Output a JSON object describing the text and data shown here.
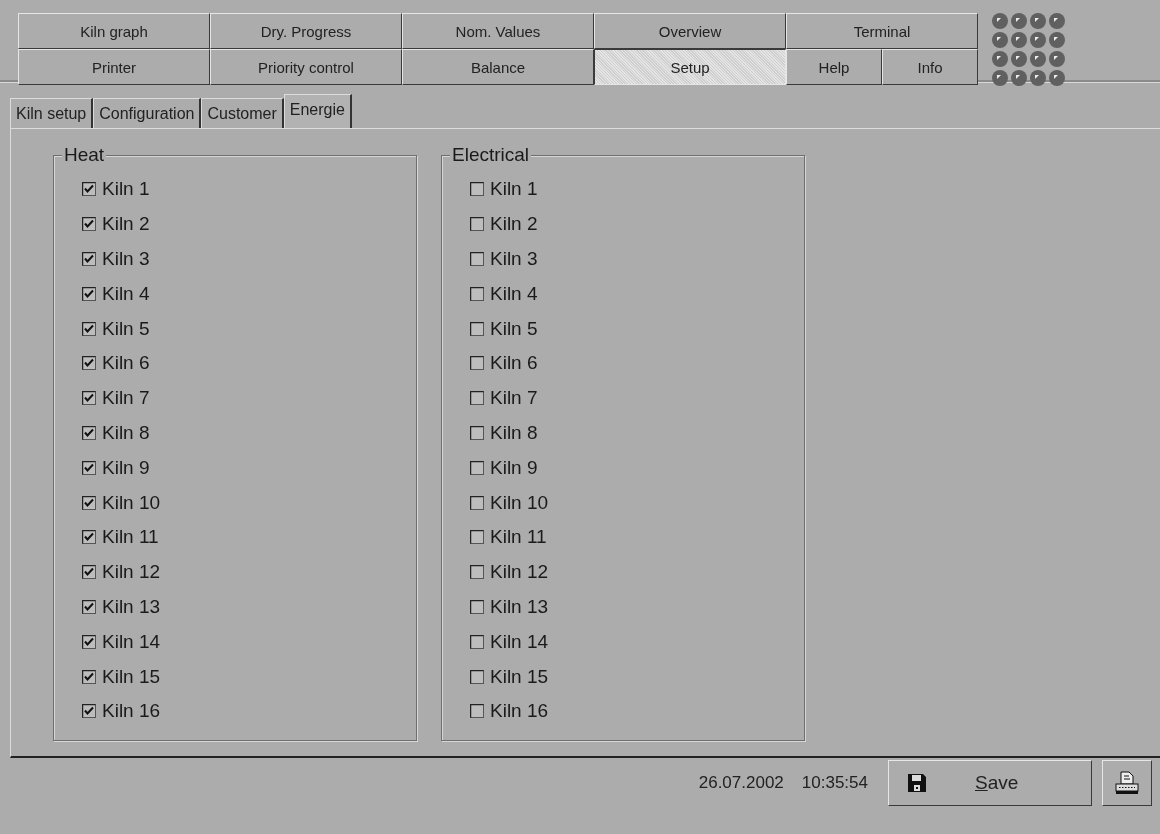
{
  "nav": [
    [
      {
        "label": "Kiln graph",
        "selected": false
      },
      {
        "label": "Dry. Progress",
        "selected": false
      },
      {
        "label": "Nom. Values",
        "selected": false
      },
      {
        "label": "Overview",
        "selected": false
      },
      {
        "label": "Terminal",
        "selected": false
      }
    ],
    [
      {
        "label": "Printer",
        "selected": false
      },
      {
        "label": "Priority control",
        "selected": false
      },
      {
        "label": "Balance",
        "selected": false
      },
      {
        "label": "Setup",
        "selected": true
      },
      {
        "label": "Help",
        "selected": false
      },
      {
        "label": "Info",
        "selected": false
      }
    ]
  ],
  "tabs": [
    {
      "label": "Kiln setup",
      "selected": false
    },
    {
      "label": "Configuration",
      "selected": false
    },
    {
      "label": "Customer",
      "selected": false
    },
    {
      "label": "Energie",
      "selected": true
    }
  ],
  "groups": [
    {
      "title": "Heat",
      "items": [
        {
          "label": "Kiln 1",
          "checked": true
        },
        {
          "label": "Kiln 2",
          "checked": true
        },
        {
          "label": "Kiln 3",
          "checked": true
        },
        {
          "label": "Kiln 4",
          "checked": true
        },
        {
          "label": "Kiln 5",
          "checked": true
        },
        {
          "label": "Kiln 6",
          "checked": true
        },
        {
          "label": "Kiln 7",
          "checked": true
        },
        {
          "label": "Kiln 8",
          "checked": true
        },
        {
          "label": "Kiln 9",
          "checked": true
        },
        {
          "label": "Kiln 10",
          "checked": true
        },
        {
          "label": "Kiln 11",
          "checked": true
        },
        {
          "label": "Kiln 12",
          "checked": true
        },
        {
          "label": "Kiln 13",
          "checked": true
        },
        {
          "label": "Kiln 14",
          "checked": true
        },
        {
          "label": "Kiln 15",
          "checked": true
        },
        {
          "label": "Kiln 16",
          "checked": true
        }
      ]
    },
    {
      "title": "Electrical",
      "items": [
        {
          "label": "Kiln 1",
          "checked": false
        },
        {
          "label": "Kiln 2",
          "checked": false
        },
        {
          "label": "Kiln 3",
          "checked": false
        },
        {
          "label": "Kiln 4",
          "checked": false
        },
        {
          "label": "Kiln 5",
          "checked": false
        },
        {
          "label": "Kiln 6",
          "checked": false
        },
        {
          "label": "Kiln 7",
          "checked": false
        },
        {
          "label": "Kiln 8",
          "checked": false
        },
        {
          "label": "Kiln 9",
          "checked": false
        },
        {
          "label": "Kiln 10",
          "checked": false
        },
        {
          "label": "Kiln 11",
          "checked": false
        },
        {
          "label": "Kiln 12",
          "checked": false
        },
        {
          "label": "Kiln 13",
          "checked": false
        },
        {
          "label": "Kiln 14",
          "checked": false
        },
        {
          "label": "Kiln 15",
          "checked": false
        },
        {
          "label": "Kiln 16",
          "checked": false
        }
      ]
    }
  ],
  "status": {
    "date": "26.07.2002",
    "time": "10:35:54",
    "save": "Save"
  }
}
